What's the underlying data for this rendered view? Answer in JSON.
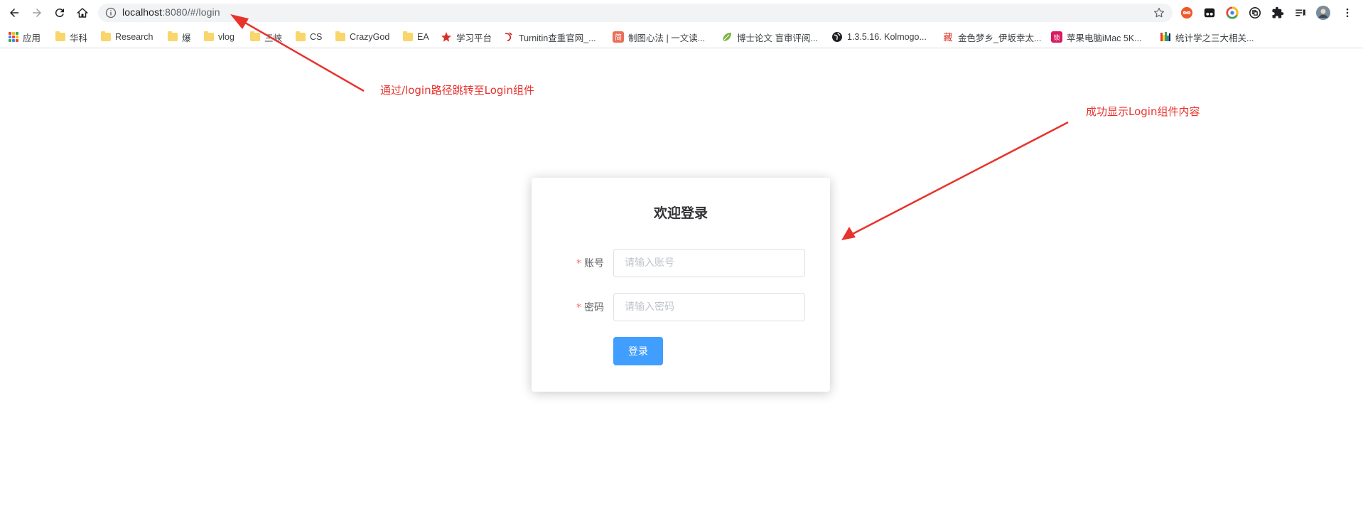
{
  "browser": {
    "url_host": "localhost",
    "url_rest": ":8080/#/login",
    "bookmarks": [
      {
        "label": "应用",
        "icon": "apps-grid-icon"
      },
      {
        "label": "华科",
        "icon": "folder-icon"
      },
      {
        "label": "Research",
        "icon": "folder-icon"
      },
      {
        "label": "爆",
        "icon": "folder-icon"
      },
      {
        "label": "vlog",
        "icon": "folder-icon"
      },
      {
        "label": "三峡",
        "icon": "folder-icon"
      },
      {
        "label": "CS",
        "icon": "folder-icon"
      },
      {
        "label": "CrazyGod",
        "icon": "folder-icon"
      },
      {
        "label": "EA",
        "icon": "folder-icon"
      },
      {
        "label": "学习平台",
        "icon": "study-platform-icon"
      },
      {
        "label": "Turnitin查重官网_...",
        "icon": "turnitin-icon"
      },
      {
        "label": "制图心法 | 一文读...",
        "icon": "jianshu-icon"
      },
      {
        "label": "博士论文 盲审评阅...",
        "icon": "leaf-icon"
      },
      {
        "label": "1.3.5.16. Kolmogo...",
        "icon": "globe-icon"
      },
      {
        "label": "金色梦乡_伊坂幸太...",
        "icon": "douban-icon"
      },
      {
        "label": "苹果电脑iMac 5K...",
        "icon": "pink-site-icon"
      },
      {
        "label": "统计学之三大相关...",
        "icon": "rainbow-icon"
      }
    ],
    "colors": {
      "accent_blue": "#409eff",
      "annotation_red": "#e8332d"
    }
  },
  "login": {
    "title": "欢迎登录",
    "account_label": "账号",
    "account_placeholder": "请输入账号",
    "password_label": "密码",
    "password_placeholder": "请输入密码",
    "required_mark": "*",
    "submit_label": "登录"
  },
  "annotations": {
    "url_note": "通过/login路径跳转至Login组件",
    "content_note": "成功显示Login组件内容"
  }
}
